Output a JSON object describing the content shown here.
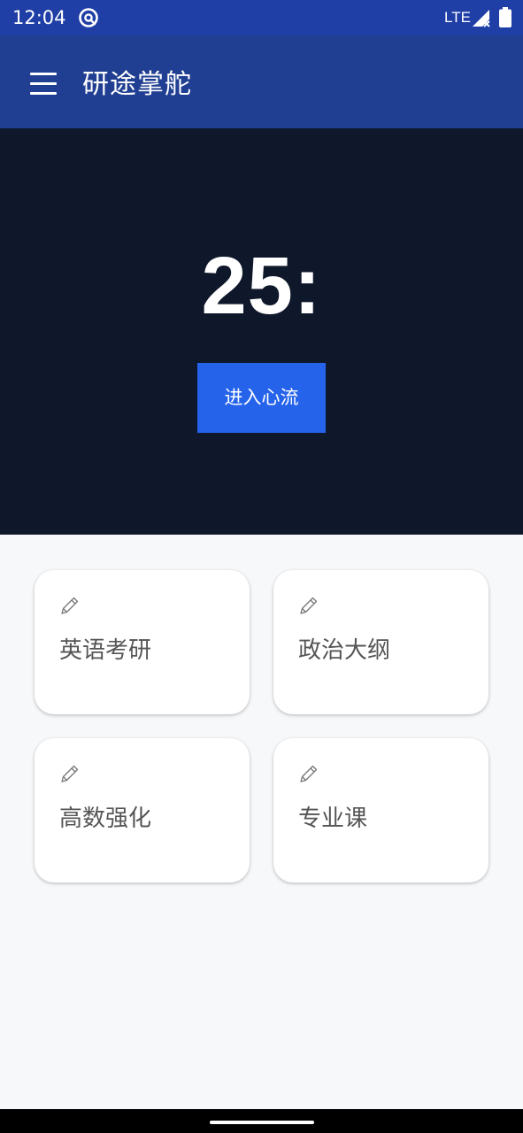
{
  "status_bar": {
    "time": "12:04",
    "app_icon": "at-sign-icon",
    "network": "LTE",
    "signal_icon": "signal-no-data-icon",
    "battery_icon": "battery-full-icon"
  },
  "app_bar": {
    "menu_icon": "hamburger-menu-icon",
    "title": "研途掌舵"
  },
  "timer": {
    "display": "25:",
    "action_label": "进入心流"
  },
  "subjects": [
    {
      "label": "英语考研",
      "icon": "pencil-icon"
    },
    {
      "label": "政治大纲",
      "icon": "pencil-icon"
    },
    {
      "label": "高数强化",
      "icon": "pencil-icon"
    },
    {
      "label": "专业课",
      "icon": "pencil-icon"
    }
  ],
  "colors": {
    "status_bar": "#1f3fa6",
    "app_bar": "#213f92",
    "hero_background": "#0f172b",
    "accent_button": "#2563eb",
    "page_background": "#f7f8fa"
  }
}
